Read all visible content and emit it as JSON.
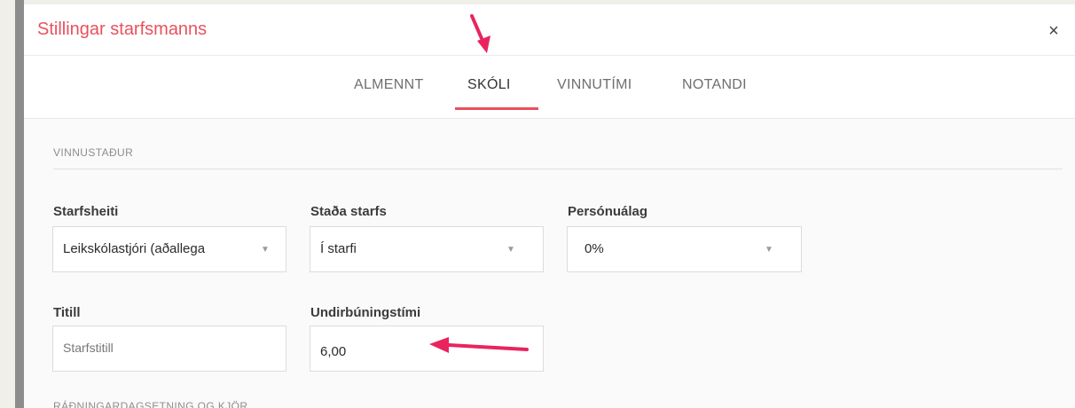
{
  "modal": {
    "title": "Stillingar starfsmanns",
    "close_icon": "×"
  },
  "tabs": [
    {
      "label": "ALMENNT",
      "active": false
    },
    {
      "label": "SKÓLI",
      "active": true
    },
    {
      "label": "VINNUTÍMI",
      "active": false
    },
    {
      "label": "NOTANDI",
      "active": false
    }
  ],
  "sections": {
    "workplace": "VINNUSTAÐUR",
    "employment": "RÁÐNINGARDAGSETNING OG KJÖR"
  },
  "fields": {
    "job_title": {
      "label": "Starfsheiti",
      "value": "Leikskólastjóri (aðallega"
    },
    "job_status": {
      "label": "Staða starfs",
      "value": "Í starfi"
    },
    "personal_rate": {
      "label": "Persónuálag",
      "value": "0%"
    },
    "title": {
      "label": "Titill",
      "placeholder": "Starfstitill"
    },
    "prep_time": {
      "label": "Undirbúningstími",
      "value": "6,00"
    }
  },
  "annotations": {
    "arrow_color": "#e8245e"
  },
  "colors": {
    "accent": "#e8515d",
    "background": "#f1efe9"
  }
}
